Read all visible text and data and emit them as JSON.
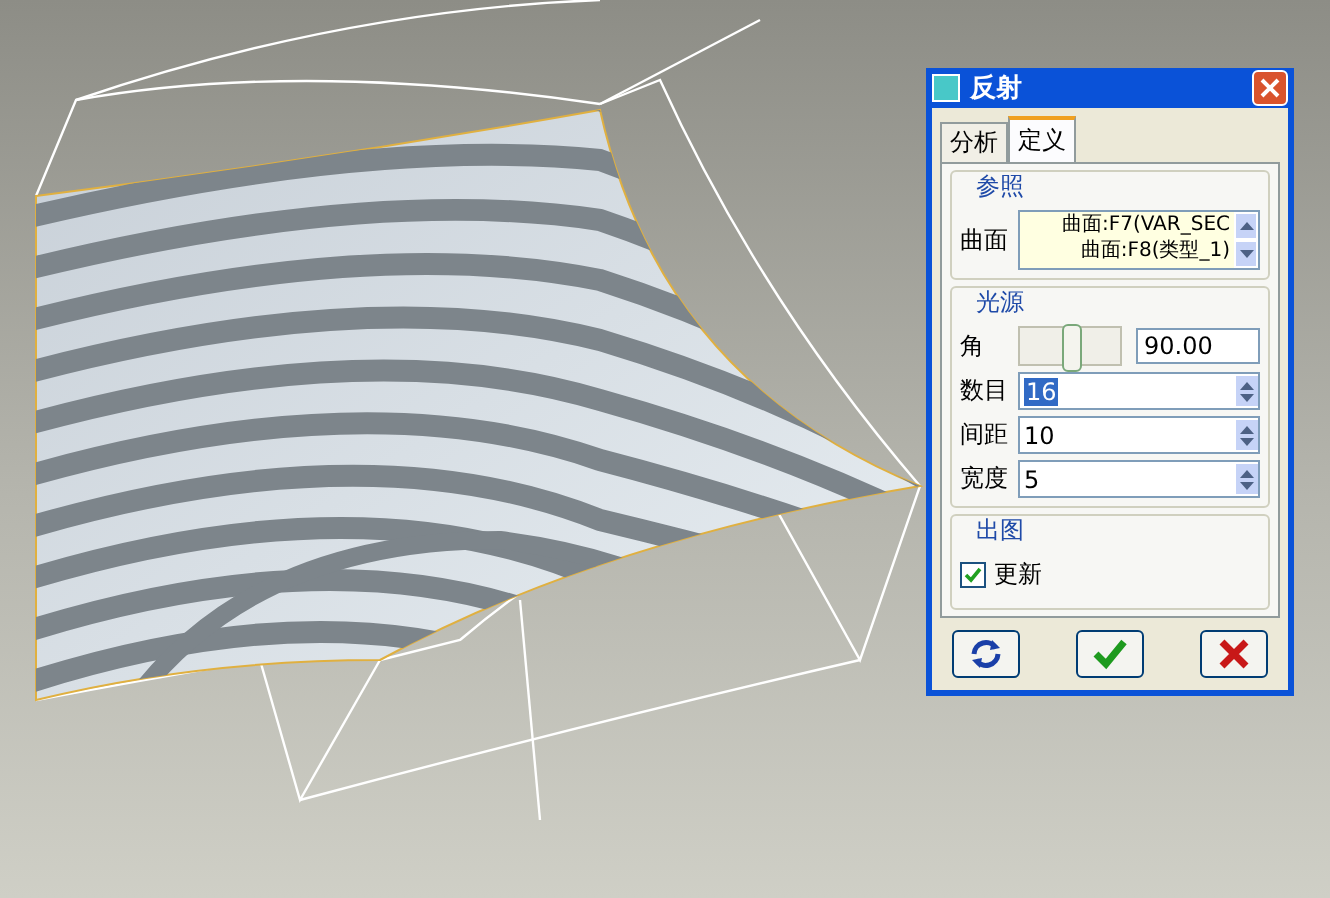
{
  "dialog": {
    "title": "反射",
    "tabs": [
      {
        "label": "分析",
        "selected": false
      },
      {
        "label": "定义",
        "selected": true
      }
    ],
    "reference": {
      "title": "参照",
      "label": "曲面",
      "items": [
        "曲面:F7(VAR_SEC",
        "曲面:F8(类型_1)"
      ]
    },
    "light": {
      "title": "光源",
      "angle": {
        "label": "角",
        "level": 0.5,
        "value": "90.00"
      },
      "fields": [
        {
          "label": "数目",
          "value": "16",
          "selected": true
        },
        {
          "label": "间距",
          "value": "10",
          "selected": false
        },
        {
          "label": "宽度",
          "value": "5",
          "selected": false
        }
      ]
    },
    "output": {
      "title": "出图",
      "checkbox": {
        "label": "更新",
        "checked": true
      }
    },
    "buttons": [
      {
        "kind": "refresh"
      },
      {
        "kind": "ok"
      },
      {
        "kind": "cancel"
      }
    ]
  }
}
